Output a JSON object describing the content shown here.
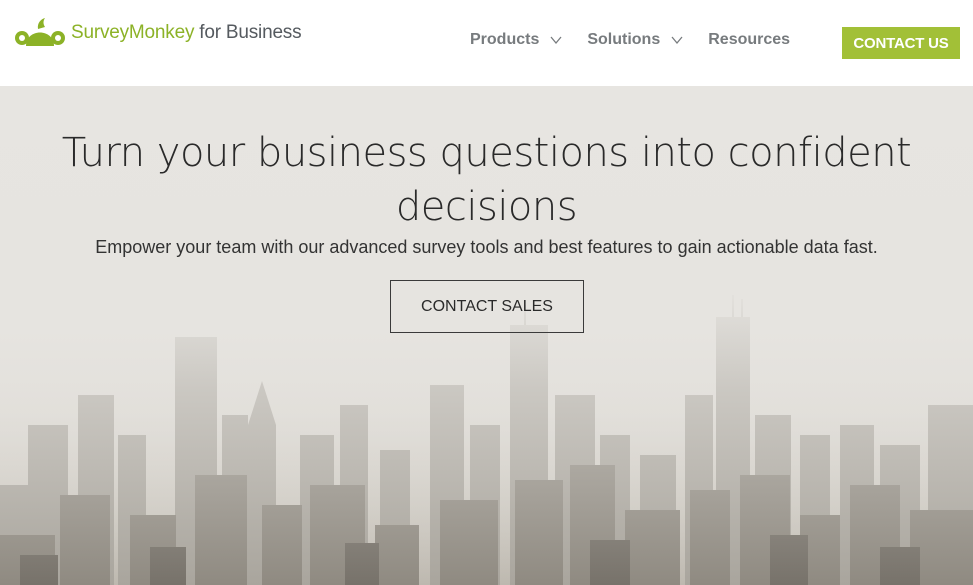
{
  "header": {
    "brand_name": "SurveyMonkey",
    "brand_suffix": "for Business",
    "nav": [
      {
        "label": "Products",
        "has_dropdown": true
      },
      {
        "label": "Solutions",
        "has_dropdown": true
      },
      {
        "label": "Resources",
        "has_dropdown": false
      }
    ],
    "contact_label": "CONTACT US"
  },
  "hero": {
    "title": "Turn your business questions into confident decisions",
    "subtitle": "Empower your team with our advanced survey tools and best features to gain actionable data fast.",
    "cta_label": "CONTACT SALES",
    "background": "city-skyline-image"
  },
  "colors": {
    "brand_green": "#8cb227",
    "button_green": "#a2c037",
    "nav_gray": "#777b7e"
  },
  "icons": [
    "surveymonkey-logo-icon",
    "chevron-down-icon"
  ]
}
